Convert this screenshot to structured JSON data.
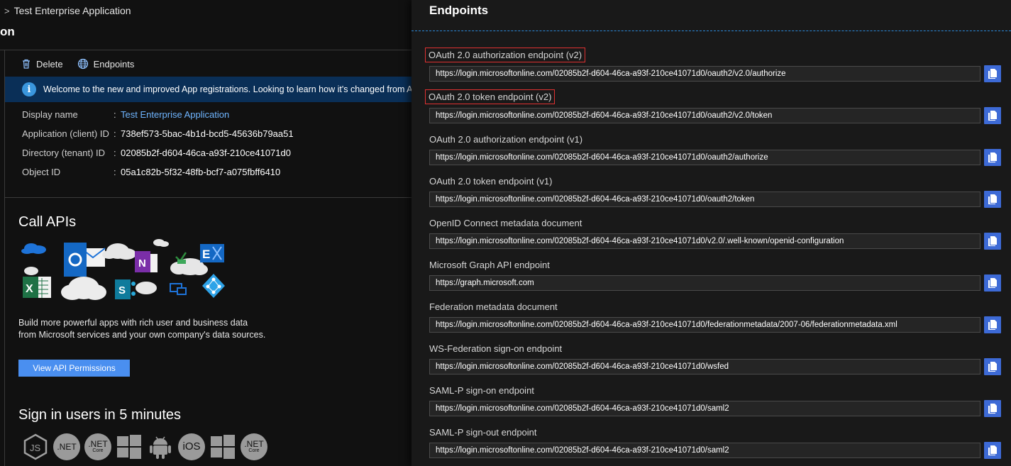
{
  "breadcrumb": {
    "chevron": ">",
    "item": "Test Enterprise Application"
  },
  "page_title_fragment": "on",
  "toolbar": {
    "delete_label": "Delete",
    "endpoints_label": "Endpoints"
  },
  "banner": {
    "text": "Welcome to the new and improved App registrations. Looking to learn how it's changed from App"
  },
  "properties": [
    {
      "label": "Display name",
      "value": "Test Enterprise Application"
    },
    {
      "label": "Application (client) ID",
      "value": "738ef573-5bac-4b1d-bcd5-45636b79aa51"
    },
    {
      "label": "Directory (tenant) ID",
      "value": "02085b2f-d604-46ca-a93f-210ce41071d0"
    },
    {
      "label": "Object ID",
      "value": "05a1c82b-5f32-48fb-bcf7-a075fbff6410"
    }
  ],
  "separator": ":",
  "call_apis": {
    "title": "Call APIs",
    "description": "Build more powerful apps with rich user and business data from Microsoft services and your own company's data sources.",
    "button": "View API Permissions"
  },
  "signin": {
    "title": "Sign in users in 5 minutes",
    "platforms": [
      {
        "name": "nodejs",
        "text": "JS"
      },
      {
        "name": "dotnet",
        "text": ".NET",
        "sub": ""
      },
      {
        "name": "dotnet-core",
        "text": ".NET",
        "sub": "Core"
      },
      {
        "name": "windows",
        "text": ""
      },
      {
        "name": "android",
        "text": ""
      },
      {
        "name": "ios",
        "text": "iOS"
      },
      {
        "name": "windows-2",
        "text": ""
      },
      {
        "name": "dotnet-core-2",
        "text": ".NET",
        "sub": "Core"
      }
    ]
  },
  "blade": {
    "title": "Endpoints",
    "endpoints": [
      {
        "label": "OAuth 2.0 authorization endpoint (v2)",
        "url": "https://login.microsoftonline.com/02085b2f-d604-46ca-a93f-210ce41071d0/oauth2/v2.0/authorize",
        "highlighted": true
      },
      {
        "label": "OAuth 2.0 token endpoint (v2)",
        "url": "https://login.microsoftonline.com/02085b2f-d604-46ca-a93f-210ce41071d0/oauth2/v2.0/token",
        "highlighted": true
      },
      {
        "label": "OAuth 2.0 authorization endpoint (v1)",
        "url": "https://login.microsoftonline.com/02085b2f-d604-46ca-a93f-210ce41071d0/oauth2/authorize",
        "highlighted": false
      },
      {
        "label": "OAuth 2.0 token endpoint (v1)",
        "url": "https://login.microsoftonline.com/02085b2f-d604-46ca-a93f-210ce41071d0/oauth2/token",
        "highlighted": false
      },
      {
        "label": "OpenID Connect metadata document",
        "url": "https://login.microsoftonline.com/02085b2f-d604-46ca-a93f-210ce41071d0/v2.0/.well-known/openid-configuration",
        "highlighted": false
      },
      {
        "label": "Microsoft Graph API endpoint",
        "url": "https://graph.microsoft.com",
        "highlighted": false
      },
      {
        "label": "Federation metadata document",
        "url": "https://login.microsoftonline.com/02085b2f-d604-46ca-a93f-210ce41071d0/federationmetadata/2007-06/federationmetadata.xml",
        "highlighted": false
      },
      {
        "label": "WS-Federation sign-on endpoint",
        "url": "https://login.microsoftonline.com/02085b2f-d604-46ca-a93f-210ce41071d0/wsfed",
        "highlighted": false
      },
      {
        "label": "SAML-P sign-on endpoint",
        "url": "https://login.microsoftonline.com/02085b2f-d604-46ca-a93f-210ce41071d0/saml2",
        "highlighted": false
      },
      {
        "label": "SAML-P sign-out endpoint",
        "url": "https://login.microsoftonline.com/02085b2f-d604-46ca-a93f-210ce41071d0/saml2",
        "highlighted": false
      }
    ]
  },
  "colors": {
    "accent": "#3d6ad6",
    "link": "#6fb5ff",
    "highlight_box": "#e03131",
    "banner": "#0a2f57"
  }
}
